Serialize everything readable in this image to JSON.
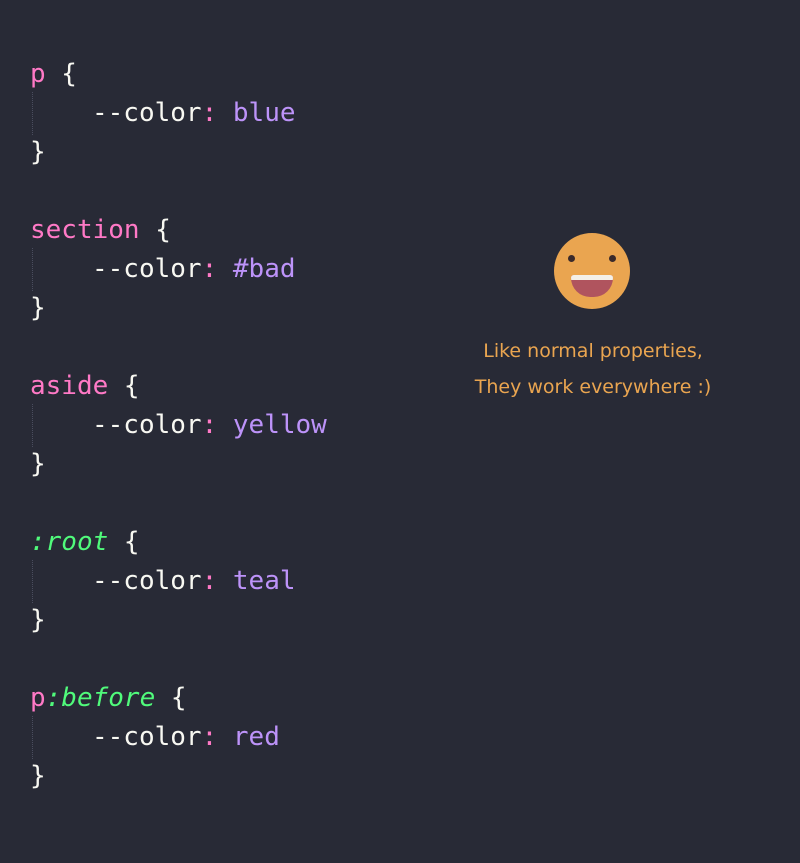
{
  "code_blocks": [
    {
      "selector": "p",
      "pseudo": "",
      "property": "--color",
      "value": "blue"
    },
    {
      "selector": "section",
      "pseudo": "",
      "property": "--color",
      "value": "#bad"
    },
    {
      "selector": "aside",
      "pseudo": "",
      "property": "--color",
      "value": "yellow"
    },
    {
      "selector": "",
      "pseudo": ":root",
      "property": "--color",
      "value": "teal"
    },
    {
      "selector": "p",
      "pseudo": ":before",
      "property": "--color",
      "value": "red"
    }
  ],
  "syntax": {
    "open_brace": " {",
    "close_brace": "}",
    "colon": ":",
    "space": " "
  },
  "annotation": {
    "icon": "smiley-face-icon",
    "line1": "Like normal properties,",
    "line2": "They work everywhere :)"
  },
  "colors": {
    "background": "#282a36",
    "selector": "#ff79c6",
    "pseudo": "#50fa7b",
    "value": "#bd93f9",
    "text": "#f8f8f2",
    "annotation": "#eaa550"
  }
}
